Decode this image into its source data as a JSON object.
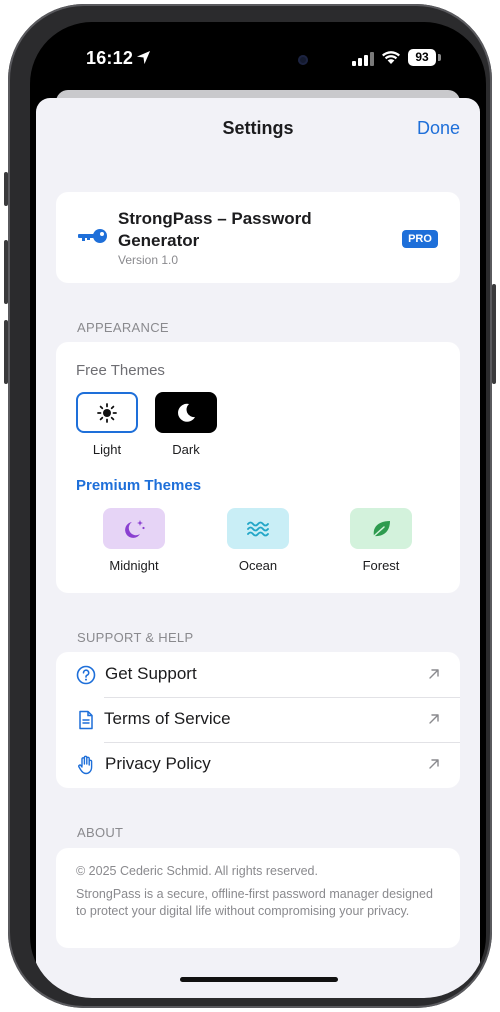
{
  "status_bar": {
    "time": "16:12",
    "battery": "93"
  },
  "header": {
    "title": "Settings",
    "done_label": "Done"
  },
  "app_info": {
    "name": "StrongPass – Password Generator",
    "version": "Version 1.0",
    "badge": "PRO",
    "icon": "key-icon"
  },
  "appearance": {
    "section_title": "APPEARANCE",
    "free_title": "Free Themes",
    "free_themes": [
      {
        "label": "Light",
        "icon": "sun-icon",
        "selected": true
      },
      {
        "label": "Dark",
        "icon": "moon-icon",
        "selected": false
      }
    ],
    "premium_title": "Premium Themes",
    "premium_themes": [
      {
        "label": "Midnight",
        "icon": "moon-stars-icon",
        "color": "#e6d4f6"
      },
      {
        "label": "Ocean",
        "icon": "waves-icon",
        "color": "#c9eef6"
      },
      {
        "label": "Forest",
        "icon": "leaf-icon",
        "color": "#d3f2dc"
      }
    ]
  },
  "support": {
    "section_title": "SUPPORT & HELP",
    "items": [
      {
        "label": "Get Support",
        "icon": "question-circle-icon"
      },
      {
        "label": "Terms of Service",
        "icon": "document-icon"
      },
      {
        "label": "Privacy Policy",
        "icon": "hand-icon"
      }
    ]
  },
  "about": {
    "section_title": "ABOUT",
    "copyright": "© 2025 Cederic Schmid. All rights reserved.",
    "description": "StrongPass is a secure, offline-first password manager designed to protect your digital life without compromising your privacy."
  },
  "colors": {
    "accent": "#1e6fd9",
    "background": "#f2f2f7",
    "card": "#ffffff"
  }
}
